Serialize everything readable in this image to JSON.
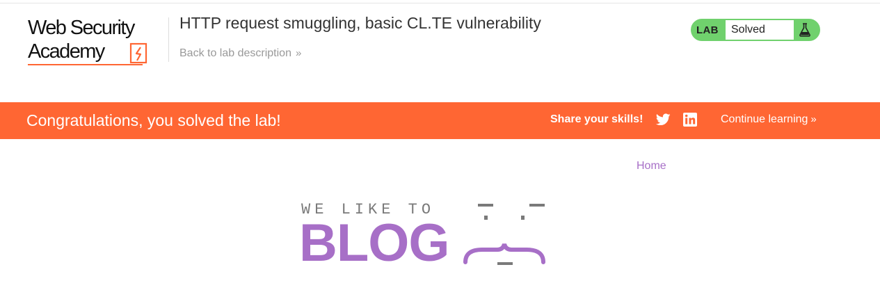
{
  "header": {
    "logo": {
      "line1": "Web Security",
      "line2": "Academy"
    },
    "lab_title": "HTTP request smuggling, basic CL.TE vulnerability",
    "back_link": "Back to lab description",
    "back_chevron": "»"
  },
  "lab_status": {
    "label": "LAB",
    "status": "Solved",
    "icon": "flask-icon",
    "accent": "#70d16d"
  },
  "banner": {
    "message": "Congratulations, you solved the lab!",
    "share_label": "Share your skills!",
    "twitter_icon": "twitter-icon",
    "linkedin_icon": "linkedin-icon",
    "continue_label": "Continue learning",
    "continue_chevron": "»",
    "color": "#ff6633"
  },
  "blog": {
    "nav_home": "Home",
    "tagline": "WE LIKE TO",
    "word": "BLOG",
    "accent": "#a76fc7"
  }
}
